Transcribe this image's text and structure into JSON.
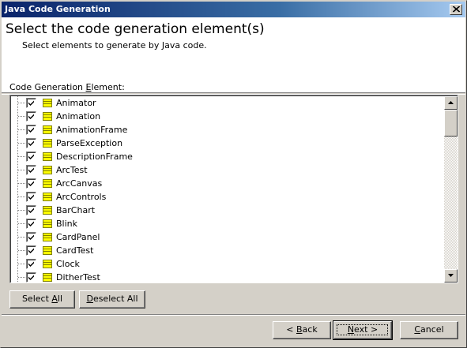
{
  "window": {
    "title": "Java Code Generation"
  },
  "header": {
    "heading": "Select the code generation element(s)",
    "subheading": "Select elements to generate by Java code."
  },
  "list": {
    "label": "Code Generation Element:",
    "items": [
      {
        "label": "Animator",
        "checked": true
      },
      {
        "label": "Animation",
        "checked": true
      },
      {
        "label": "AnimationFrame",
        "checked": true
      },
      {
        "label": "ParseException",
        "checked": true
      },
      {
        "label": "DescriptionFrame",
        "checked": true
      },
      {
        "label": "ArcTest",
        "checked": true
      },
      {
        "label": "ArcCanvas",
        "checked": true
      },
      {
        "label": "ArcControls",
        "checked": true
      },
      {
        "label": "BarChart",
        "checked": true
      },
      {
        "label": "Blink",
        "checked": true
      },
      {
        "label": "CardPanel",
        "checked": true
      },
      {
        "label": "CardTest",
        "checked": true
      },
      {
        "label": "Clock",
        "checked": true
      },
      {
        "label": "DitherTest",
        "checked": true
      }
    ]
  },
  "buttons": {
    "select_all": "Select All",
    "deselect_all": "Deselect All",
    "back": "< Back",
    "next": "Next >",
    "cancel": "Cancel"
  },
  "icons": {
    "close": "close-icon",
    "check": "checkmark-icon",
    "class": "class-icon",
    "scroll_up": "arrow-up-icon",
    "scroll_down": "arrow-down-icon"
  },
  "colors": {
    "title_start": "#0a246a",
    "title_end": "#a6caf0",
    "face": "#d4d0c8",
    "class_icon": "#ffff00"
  }
}
